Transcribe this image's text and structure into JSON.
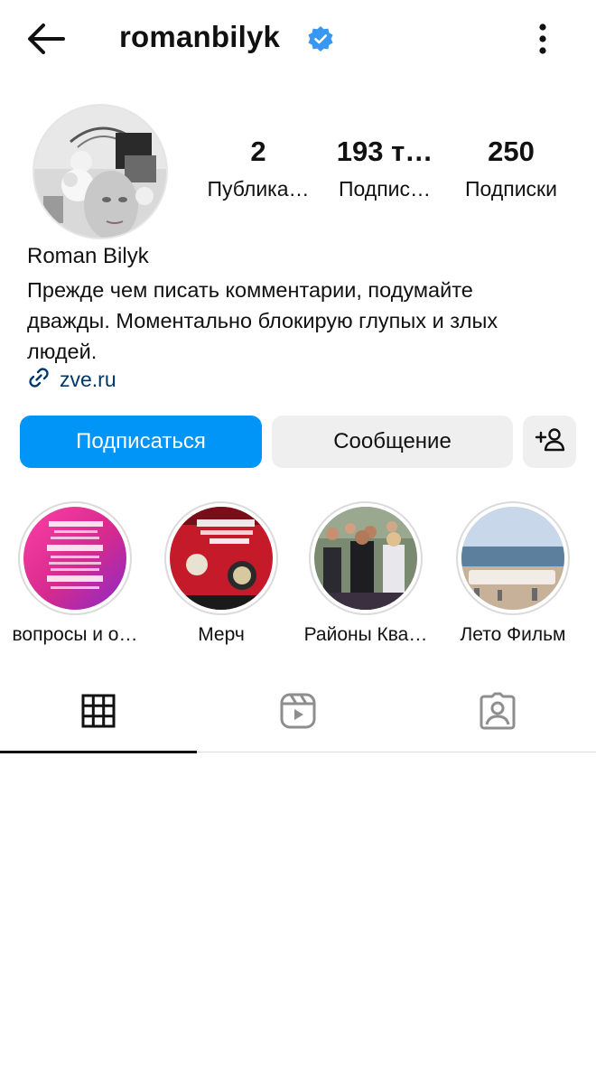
{
  "header": {
    "username": "romanbilyk",
    "verified": true
  },
  "stats": {
    "posts": {
      "value": "2",
      "label": "Публика…"
    },
    "followers": {
      "value": "193 т…",
      "label": "Подпис…"
    },
    "following": {
      "value": "250",
      "label": "Подписки"
    }
  },
  "profile": {
    "full_name": "Roman Bilyk",
    "bio_lines": [
      "Прежде чем писать комментарии,  подумайте",
      "дважды. Моментально блокирую глупых и злых",
      "людей."
    ],
    "link": "zve.ru"
  },
  "actions": {
    "follow": "Подписаться",
    "message": "Сообщение"
  },
  "highlights": [
    {
      "label": "вопросы и о…"
    },
    {
      "label": "Мерч"
    },
    {
      "label": "Районы Ква…"
    },
    {
      "label": "Лето Фильм"
    }
  ],
  "tabs": [
    "grid-icon",
    "reels-icon",
    "tagged-icon"
  ],
  "colors": {
    "accent": "#0095f6",
    "verified": "#3897f0",
    "link": "#00376b",
    "button_secondary": "#efefef"
  }
}
